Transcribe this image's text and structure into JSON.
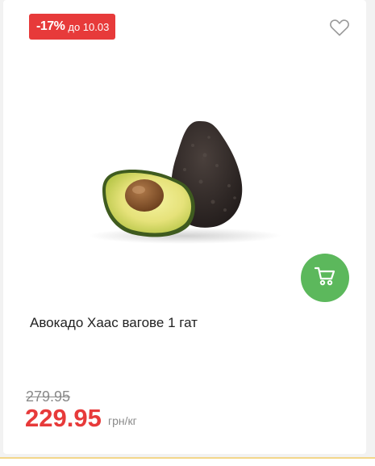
{
  "product_card": {
    "discount": {
      "percent": "-17%",
      "until": "до 10.03",
      "color": "#e73a3a"
    },
    "favorite_icon": "heart-outline-icon",
    "image_alt": "avocado",
    "cart_icon": "shopping-cart-icon",
    "cart_button_color": "#5cb85c",
    "name": "Авокадо Хаас вагове 1 гат",
    "old_price": "279.95",
    "new_price": "229.95",
    "unit": "грн/кг"
  }
}
